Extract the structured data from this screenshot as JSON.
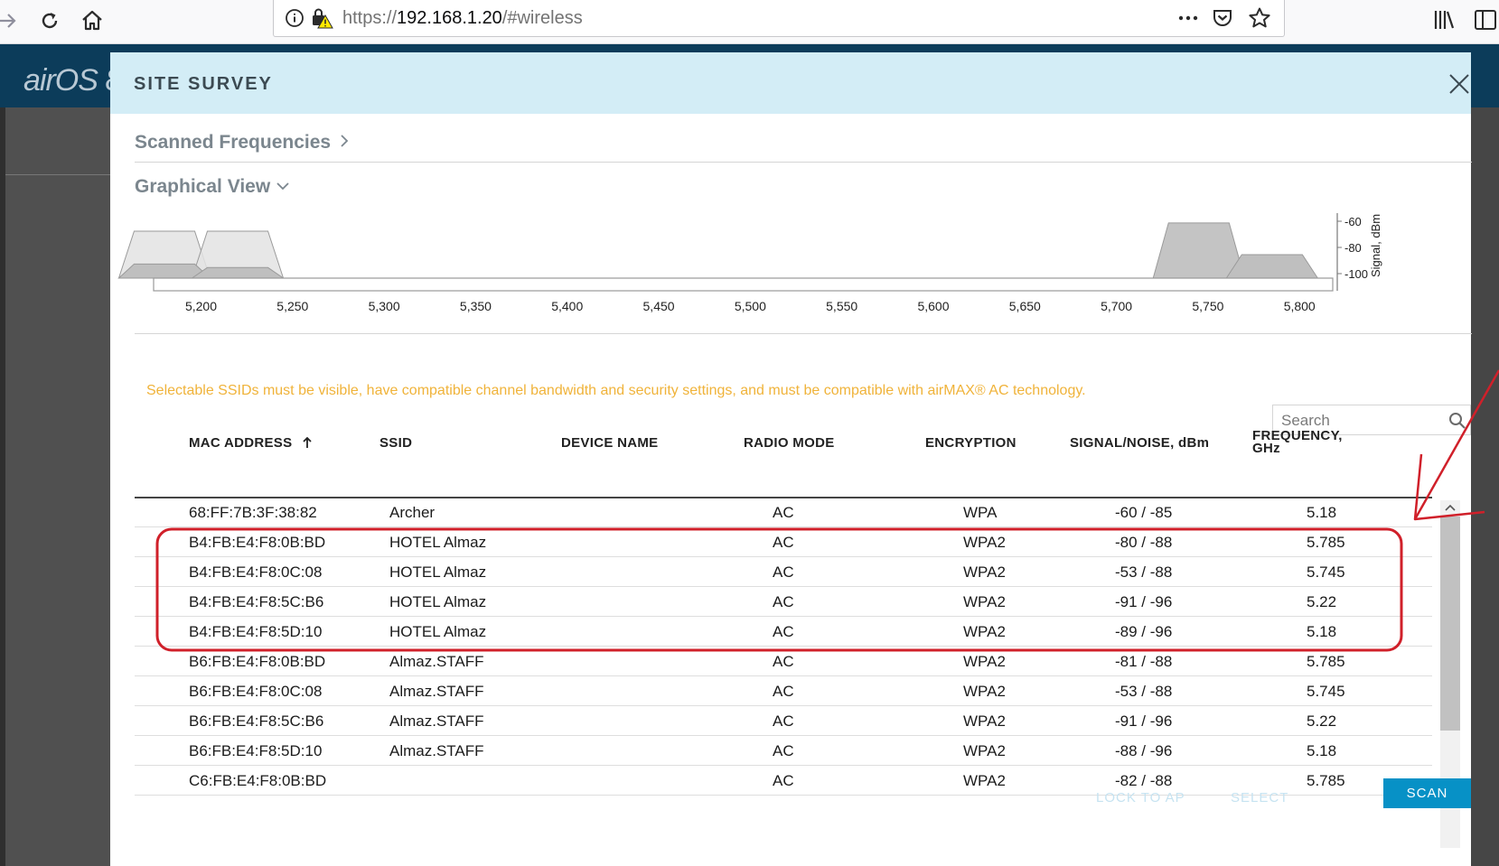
{
  "browser": {
    "url_prefix": "https://",
    "url_host": "192.168.1.20",
    "url_path": "/#wireless"
  },
  "app": {
    "logo": "airOS 8"
  },
  "modal": {
    "title": "SITE SURVEY",
    "scanned_frequencies_label": "Scanned Frequencies",
    "graphical_view_label": "Graphical View",
    "notice": "Selectable SSIDs must be visible, have compatible channel bandwidth and security settings, and must be compatible with airMAX® AC technology.",
    "search_placeholder": "Search",
    "buttons": {
      "lock_to_ap": "LOCK TO AP",
      "select": "SELECT",
      "scan": "SCAN"
    }
  },
  "graph": {
    "x_ticks": [
      "5,200",
      "5,250",
      "5,300",
      "5,350",
      "5,400",
      "5,450",
      "5,500",
      "5,550",
      "5,600",
      "5,650",
      "5,700",
      "5,750",
      "5,800"
    ],
    "y_ticks": [
      "-60",
      "-80",
      "-100"
    ],
    "y_label": "Signal, dBm",
    "channels": [
      {
        "freq": 5180,
        "signal": -60
      },
      {
        "freq": 5220,
        "signal": -60
      },
      {
        "freq": 5180,
        "signal": -88
      },
      {
        "freq": 5220,
        "signal": -91
      },
      {
        "freq": 5745,
        "signal": -53
      },
      {
        "freq": 5785,
        "signal": -80
      }
    ]
  },
  "table": {
    "headers": {
      "mac": "MAC ADDRESS",
      "ssid": "SSID",
      "device": "DEVICE NAME",
      "radio": "RADIO MODE",
      "encryption": "ENCRYPTION",
      "signal": "SIGNAL/NOISE, dBm",
      "frequency_1": "FREQUENCY,",
      "frequency_2": "GHz"
    },
    "rows": [
      {
        "mac": "68:FF:7B:3F:38:82",
        "ssid": "Archer",
        "device": "",
        "radio": "AC",
        "enc": "WPA",
        "sig": "-60 / -85",
        "freq": "5.18"
      },
      {
        "mac": "B4:FB:E4:F8:0B:BD",
        "ssid": "HOTEL Almaz",
        "device": "",
        "radio": "AC",
        "enc": "WPA2",
        "sig": "-80 / -88",
        "freq": "5.785"
      },
      {
        "mac": "B4:FB:E4:F8:0C:08",
        "ssid": "HOTEL Almaz",
        "device": "",
        "radio": "AC",
        "enc": "WPA2",
        "sig": "-53 / -88",
        "freq": "5.745"
      },
      {
        "mac": "B4:FB:E4:F8:5C:B6",
        "ssid": "HOTEL Almaz",
        "device": "",
        "radio": "AC",
        "enc": "WPA2",
        "sig": "-91 / -96",
        "freq": "5.22"
      },
      {
        "mac": "B4:FB:E4:F8:5D:10",
        "ssid": "HOTEL Almaz",
        "device": "",
        "radio": "AC",
        "enc": "WPA2",
        "sig": "-89 / -96",
        "freq": "5.18"
      },
      {
        "mac": "B6:FB:E4:F8:0B:BD",
        "ssid": "Almaz.STAFF",
        "device": "",
        "radio": "AC",
        "enc": "WPA2",
        "sig": "-81 / -88",
        "freq": "5.785"
      },
      {
        "mac": "B6:FB:E4:F8:0C:08",
        "ssid": "Almaz.STAFF",
        "device": "",
        "radio": "AC",
        "enc": "WPA2",
        "sig": "-53 / -88",
        "freq": "5.745"
      },
      {
        "mac": "B6:FB:E4:F8:5C:B6",
        "ssid": "Almaz.STAFF",
        "device": "",
        "radio": "AC",
        "enc": "WPA2",
        "sig": "-91 / -96",
        "freq": "5.22"
      },
      {
        "mac": "B6:FB:E4:F8:5D:10",
        "ssid": "Almaz.STAFF",
        "device": "",
        "radio": "AC",
        "enc": "WPA2",
        "sig": "-88 / -96",
        "freq": "5.18"
      },
      {
        "mac": "C6:FB:E4:F8:0B:BD",
        "ssid": "",
        "device": "",
        "radio": "AC",
        "enc": "WPA2",
        "sig": "-82 / -88",
        "freq": "5.785"
      }
    ]
  },
  "colors": {
    "modal_header": "#d3edf6",
    "notice": "#f0b33a",
    "scan_button": "#0791c6",
    "annotation": "#d0202a"
  }
}
